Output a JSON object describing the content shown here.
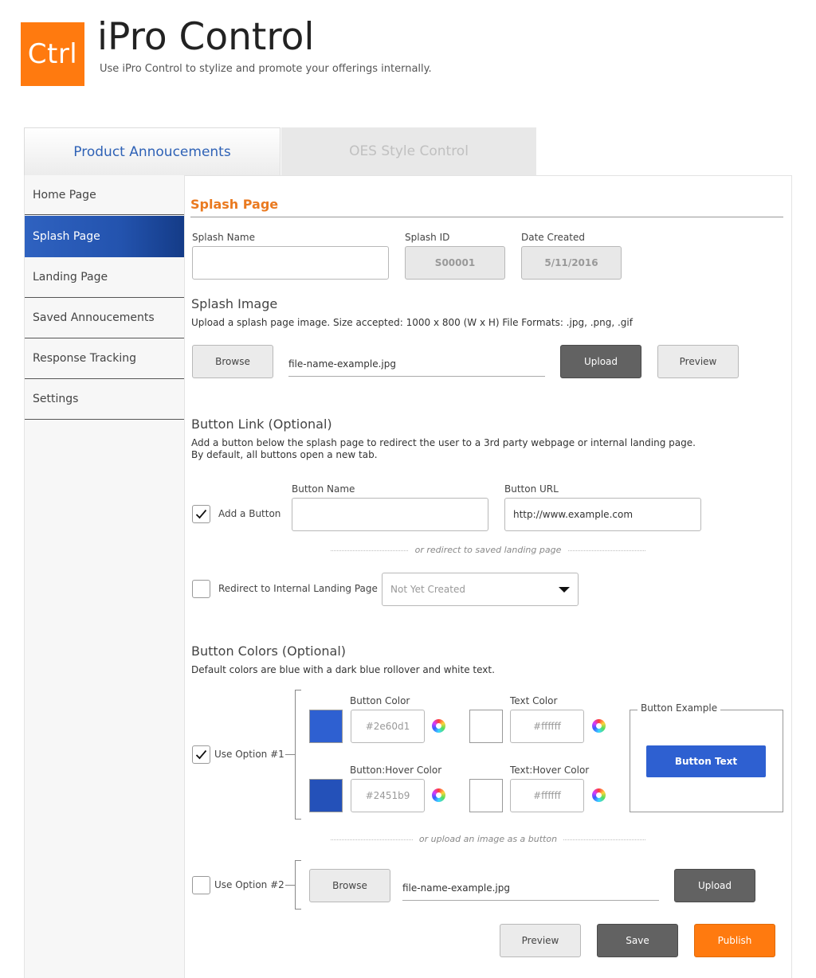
{
  "header": {
    "logo_text": "Ctrl",
    "title": "iPro Control",
    "subtitle": "Use iPro Control to stylize and promote your offerings internally."
  },
  "tabs": [
    {
      "label": "Product Annoucements",
      "active": true
    },
    {
      "label": "OES Style Control",
      "active": false
    }
  ],
  "sidebar": {
    "items": [
      {
        "label": "Home Page"
      },
      {
        "label": "Splash Page",
        "active": true
      },
      {
        "label": "Landing Page"
      },
      {
        "label": "Saved Annoucements"
      },
      {
        "label": "Response Tracking"
      },
      {
        "label": "Settings"
      }
    ]
  },
  "splash": {
    "section_title": "Splash Page",
    "name_label": "Splash Name",
    "name_value": "",
    "id_label": "Splash ID",
    "id_value": "S00001",
    "date_label": "Date Created",
    "date_value": "5/11/2016",
    "image_heading": "Splash Image",
    "image_desc": "Upload a splash page image.  Size accepted: 1000 x 800 (W x H)  File Formats: .jpg, .png, .gif",
    "browse_label": "Browse",
    "file_name": "file-name-example.jpg",
    "upload_label": "Upload",
    "preview_label": "Preview"
  },
  "button_link": {
    "heading": "Button Link (Optional)",
    "desc_line1": "Add a button below the splash page to redirect the user to a 3rd party webpage or internal landing page.",
    "desc_line2": "By default, all buttons open a new tab.",
    "add_button_label": "Add a Button",
    "add_button_checked": true,
    "button_name_label": "Button Name",
    "button_name_value": "",
    "button_url_label": "Button URL",
    "button_url_value": "http://www.example.com",
    "divider_text": "or redirect to saved landing page",
    "redirect_label": "Redirect to Internal Landing Page",
    "redirect_checked": false,
    "landing_select_value": "Not Yet Created"
  },
  "button_colors": {
    "heading": "Button Colors (Optional)",
    "desc": "Default colors are blue with a dark blue rollover and white text.",
    "option1_label": "Use Option #1",
    "option1_checked": true,
    "button_color_label": "Button Color",
    "button_color_value": "#2e60d1",
    "text_color_label": "Text Color",
    "text_color_value": "#ffffff",
    "hover_color_label": "Button:Hover Color",
    "hover_color_value": "#2451b9",
    "text_hover_label": "Text:Hover Color",
    "text_hover_value": "#ffffff",
    "example_legend": "Button Example",
    "example_button_text": "Button Text",
    "divider_text": "or upload an image as a button",
    "option2_label": "Use Option #2",
    "option2_checked": false,
    "browse_label": "Browse",
    "file_name": "file-name-example.jpg",
    "upload_label": "Upload"
  },
  "footer_actions": {
    "preview_label": "Preview",
    "save_label": "Save",
    "publish_label": "Publish"
  },
  "colors": {
    "brand_orange": "#ff7a0f",
    "accent_blue": "#2f62b6",
    "section_title_orange": "#ea7a20"
  }
}
